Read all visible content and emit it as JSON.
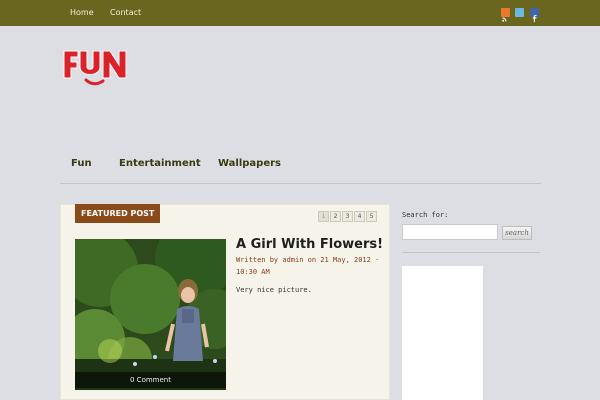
{
  "topbar": {
    "nav": [
      "Home",
      "Contact"
    ],
    "social_icons": [
      "rss-icon",
      "twitter-icon",
      "facebook-icon"
    ],
    "colors": {
      "background": "#6a6620",
      "rss": "#e87a2c",
      "twitter": "#6ab8e0",
      "facebook": "#3f66a8"
    }
  },
  "logo": {
    "text": "FUN",
    "color": "#d9222a"
  },
  "main_nav": [
    "Fun",
    "Entertainment",
    "Wallpapers"
  ],
  "featured": {
    "label": "FEATURED POST",
    "pages": [
      "1",
      "2",
      "3",
      "4",
      "5"
    ],
    "current_page": "1",
    "post": {
      "title": "A Girl With Flowers!",
      "meta": "Written by admin on 21 May, 2012 - 10:30 AM",
      "excerpt": "Very nice picture.",
      "comments": "0 Comment"
    }
  },
  "sidebar": {
    "search_label": "Search for:",
    "search_value": "",
    "search_button": "search"
  }
}
